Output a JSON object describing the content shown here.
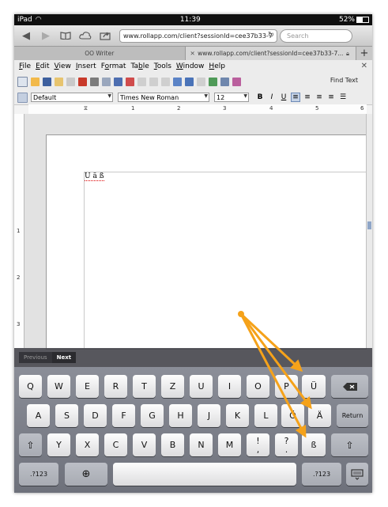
{
  "status": {
    "device": "iPad",
    "wifi_icon": "wifi-icon",
    "time": "11:39",
    "battery": "52%"
  },
  "browser": {
    "url": "www.rollapp.com/client?sessionId=cee37b33-7",
    "search_placeholder": "Search",
    "tabs": [
      {
        "label": "OO Writer"
      },
      {
        "label": "www.rollapp.com/client?sessionId=cee37b33-7..."
      }
    ]
  },
  "menubar": [
    "File",
    "Edit",
    "View",
    "Insert",
    "Format",
    "Table",
    "Tools",
    "Window",
    "Help"
  ],
  "menu_underlines": [
    "F",
    "E",
    "V",
    "I",
    "o",
    "b",
    "T",
    "W",
    "H"
  ],
  "menu_rest": [
    "ile",
    "dit",
    "iew",
    "nsert",
    "rmat",
    "le",
    "ools",
    "indow",
    "elp"
  ],
  "menu_pre": [
    "",
    "",
    "",
    "",
    "F",
    "Ta",
    "",
    "",
    ""
  ],
  "toolbar": {
    "find_text": "Find Text"
  },
  "format": {
    "style": "Default",
    "font": "Times New Roman",
    "size": "12",
    "bold": "B",
    "italic": "I",
    "underline": "U"
  },
  "ruler": {
    "h_ticks": [
      "1",
      "2",
      "3",
      "4",
      "5",
      "6"
    ],
    "v_ticks": [
      "1",
      "2",
      "3"
    ]
  },
  "document": {
    "text": "U ä ß"
  },
  "accessory": {
    "previous": "Previous",
    "next": "Next"
  },
  "keyboard": {
    "row1": [
      "Q",
      "W",
      "E",
      "R",
      "T",
      "Z",
      "U",
      "I",
      "O",
      "P",
      "Ü"
    ],
    "row2": [
      "A",
      "S",
      "D",
      "F",
      "G",
      "H",
      "J",
      "K",
      "L",
      "Ö",
      "Ä"
    ],
    "row3": [
      "Y",
      "X",
      "C",
      "V",
      "B",
      "N",
      "M",
      "ß"
    ],
    "punct": [
      {
        "top": "!",
        "bottom": ","
      },
      {
        "top": "?",
        "bottom": "."
      }
    ],
    "return_label": "Return",
    "numbers_label": ".?123"
  },
  "colors": {
    "annotation": "#f5a21a",
    "keyboard_bg": "#7c7f89"
  }
}
